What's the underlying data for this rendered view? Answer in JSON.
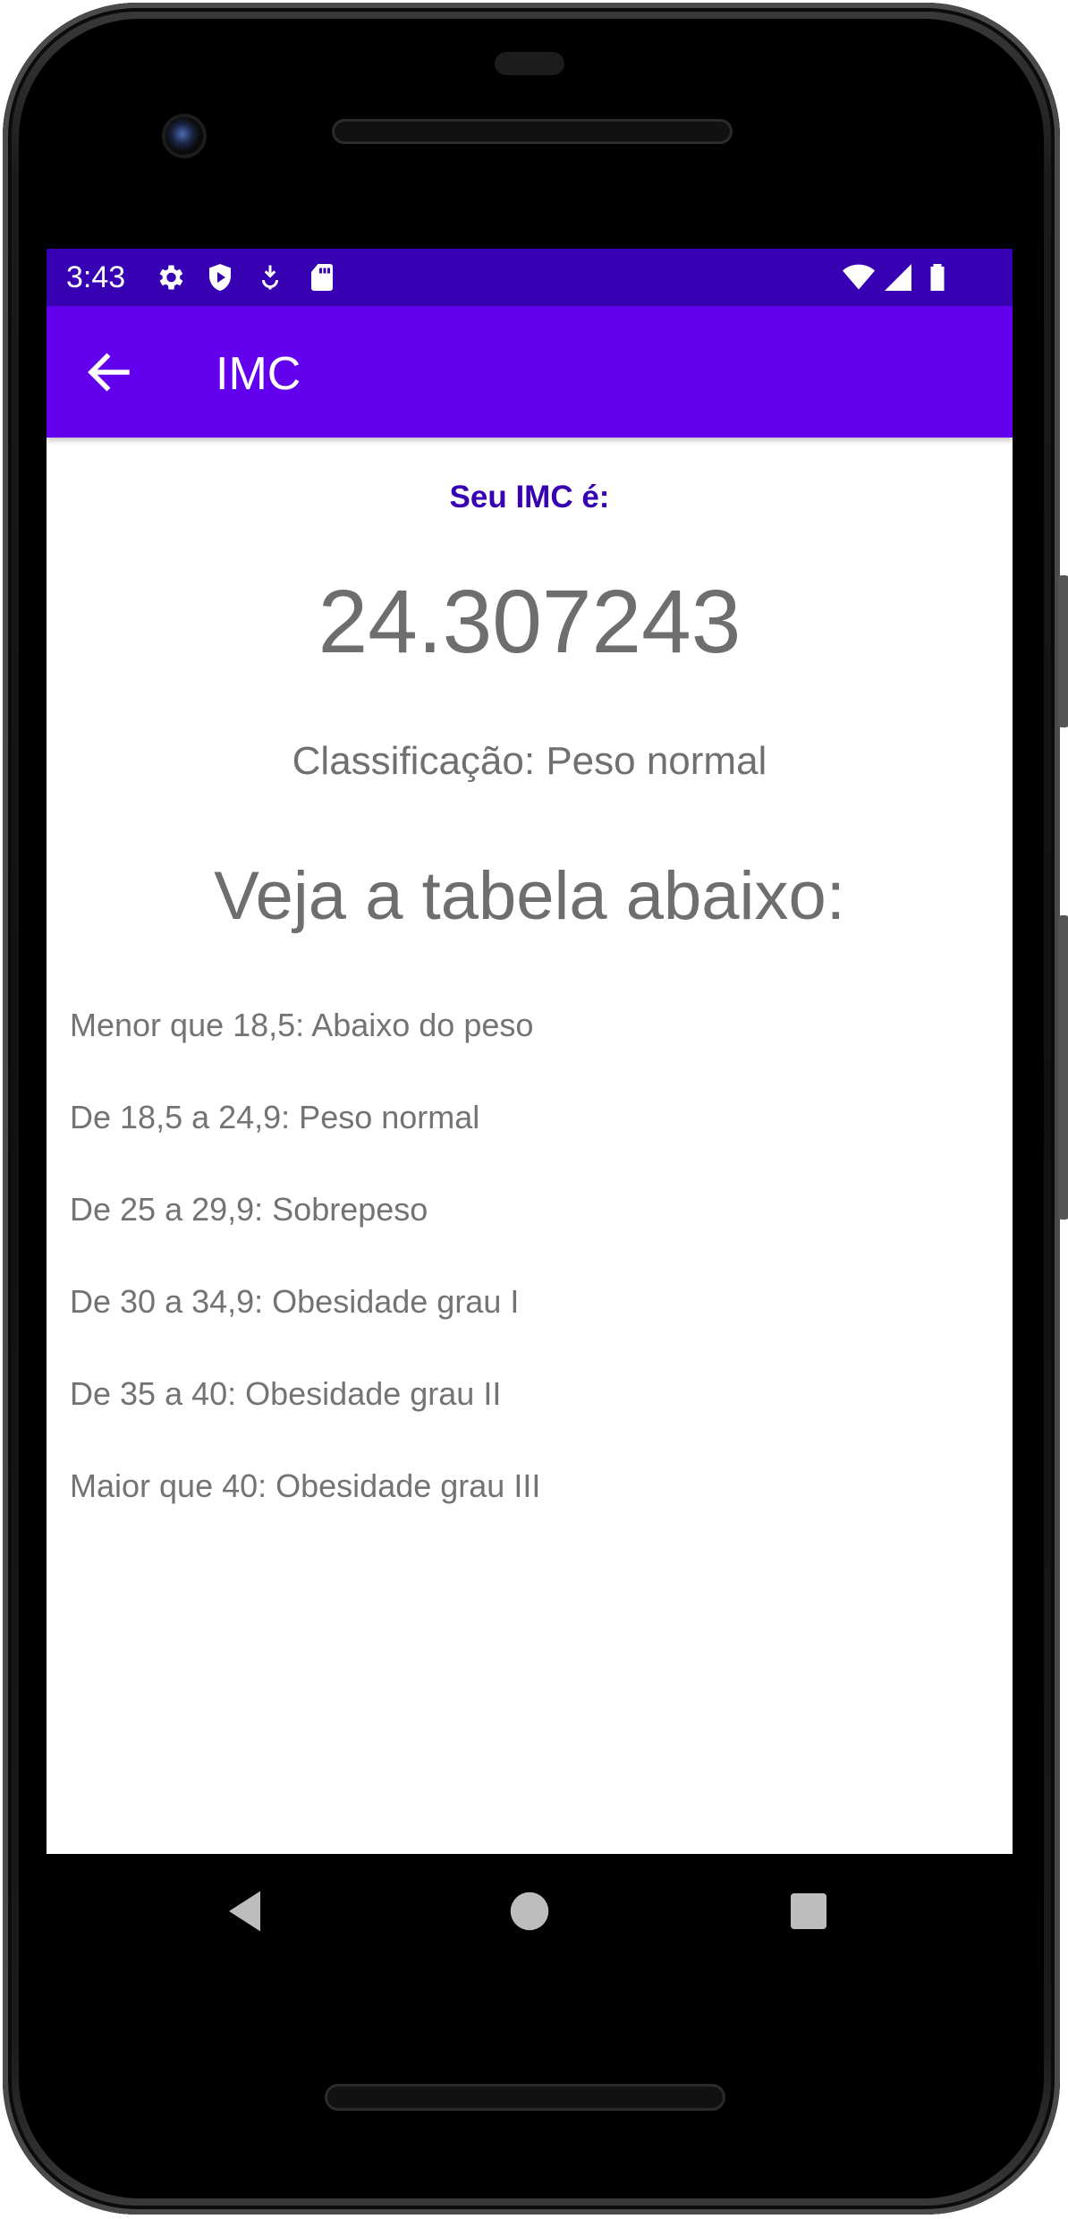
{
  "status_bar": {
    "time": "3:43",
    "left_icons": [
      "settings-icon",
      "shield-icon",
      "location-download-icon",
      "sd-card-icon"
    ],
    "right_icons": [
      "wifi-icon",
      "cell-signal-icon",
      "battery-icon"
    ],
    "background": "#3700b3"
  },
  "app_bar": {
    "title": "IMC",
    "back_icon": "arrow-back-icon",
    "background": "#6200ee"
  },
  "result": {
    "label": "Seu IMC é:",
    "value": "24.307243",
    "classification": "Classificação: Peso normal"
  },
  "table": {
    "heading": "Veja a tabela abaixo:",
    "items": [
      "Menor que 18,5: Abaixo do peso",
      "De 18,5 a 24,9: Peso normal",
      "De 25 a 29,9: Sobrepeso",
      "De 30 a 34,9: Obesidade grau I",
      "De 35 a 40: Obesidade grau II",
      "Maior que 40: Obesidade grau III"
    ]
  },
  "nav_bar": {
    "buttons": [
      "back-triangle-icon",
      "home-circle-icon",
      "recents-square-icon"
    ]
  },
  "colors": {
    "accent_dark": "#3700b3",
    "accent": "#6200ee",
    "text_gray": "#707070"
  }
}
